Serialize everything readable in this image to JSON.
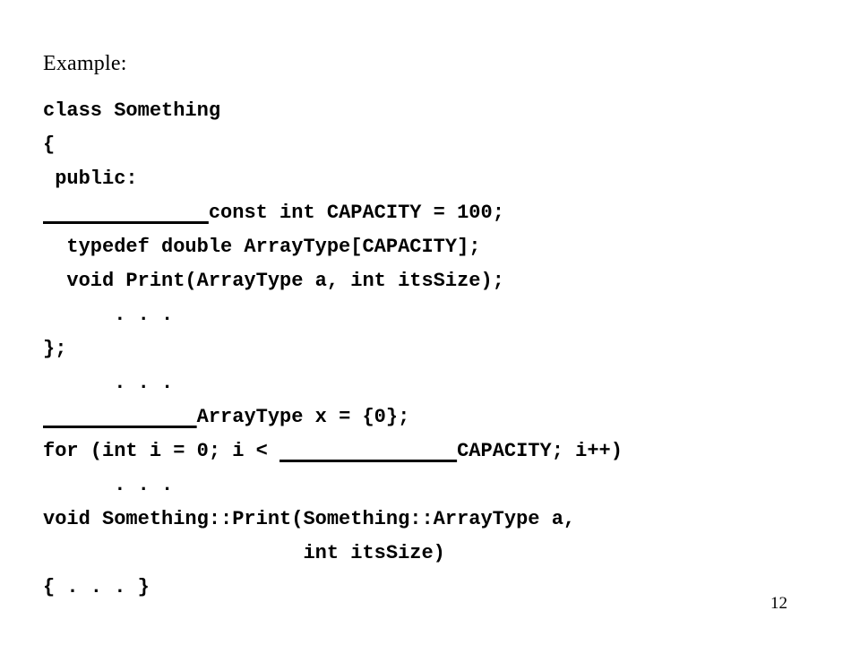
{
  "slide": {
    "title": "Example:",
    "page_number": "12",
    "background_color": "#ffffff",
    "text_color": "#000000",
    "code_lines": [
      {
        "segments": [
          {
            "kind": "text",
            "value": "class Something"
          }
        ]
      },
      {
        "segments": [
          {
            "kind": "text",
            "value": "{"
          }
        ]
      },
      {
        "segments": [
          {
            "kind": "text",
            "value": " public:"
          }
        ]
      },
      {
        "segments": [
          {
            "kind": "blank",
            "value": "   _________  "
          },
          {
            "kind": "text",
            "value": "const int CAPACITY = 100;"
          }
        ]
      },
      {
        "segments": [
          {
            "kind": "text",
            "value": "  typedef double ArrayType[CAPACITY];"
          }
        ]
      },
      {
        "segments": [
          {
            "kind": "text",
            "value": ""
          }
        ]
      },
      {
        "segments": [
          {
            "kind": "text",
            "value": "  void Print(ArrayType a, int itsSize);"
          }
        ]
      },
      {
        "segments": [
          {
            "kind": "text",
            "value": "      . . ."
          }
        ]
      },
      {
        "segments": [
          {
            "kind": "text",
            "value": "};"
          }
        ]
      },
      {
        "segments": [
          {
            "kind": "text",
            "value": "      . . ."
          }
        ]
      },
      {
        "segments": [
          {
            "kind": "text",
            "value": ""
          }
        ]
      },
      {
        "segments": [
          {
            "kind": "blank",
            "value": "_____________"
          },
          {
            "kind": "text",
            "value": "ArrayType x = {0};"
          }
        ]
      },
      {
        "segments": [
          {
            "kind": "text",
            "value": ""
          }
        ]
      },
      {
        "segments": [
          {
            "kind": "text",
            "value": "for (int i = 0; i < "
          },
          {
            "kind": "blank",
            "value": "_______________"
          },
          {
            "kind": "text",
            "value": "CAPACITY; i++)"
          }
        ]
      },
      {
        "segments": [
          {
            "kind": "text",
            "value": "      . . ."
          }
        ]
      },
      {
        "segments": [
          {
            "kind": "text",
            "value": "void Something::Print(Something::ArrayType a,"
          }
        ]
      },
      {
        "segments": [
          {
            "kind": "text",
            "value": "                      int itsSize)"
          }
        ]
      },
      {
        "segments": [
          {
            "kind": "text",
            "value": "{ . . . }"
          }
        ]
      }
    ]
  }
}
